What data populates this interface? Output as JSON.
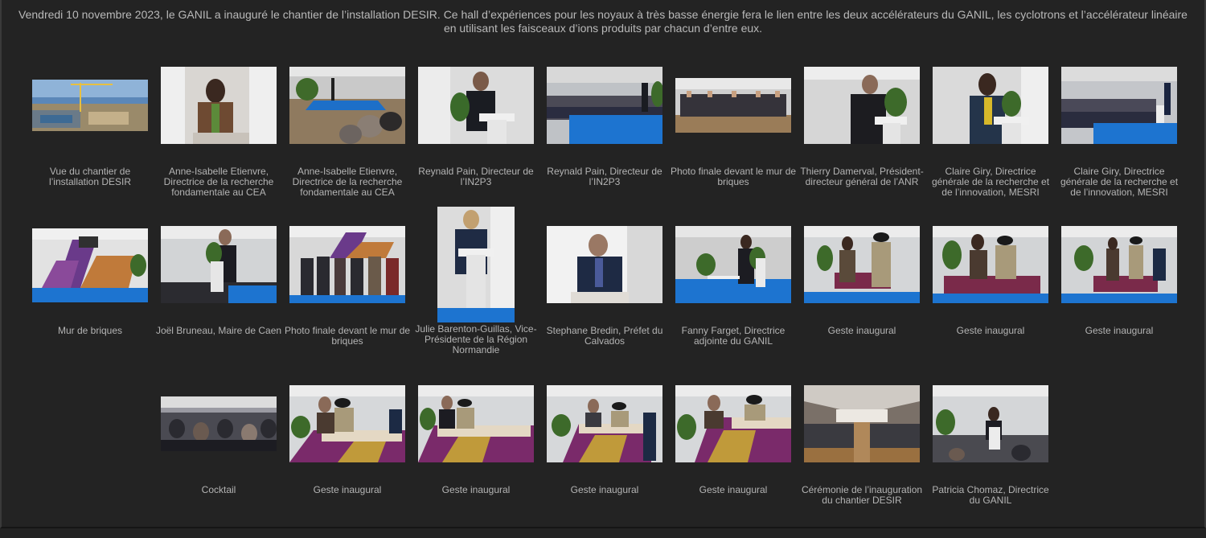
{
  "intro": {
    "line1": "Vendredi 10 novembre 2023, le GANIL a inauguré le chantier de l’installation DESIR. Ce hall d’expériences pour les noyaux à très basse énergie fera le lien entre les deux accélérateurs du GANIL, les cyclotrons et l’accélérateur linéaire",
    "line2": "en utilisant les faisceaux d’ions produits par chacun d’entre eux."
  },
  "gallery": [
    {
      "caption": "Vue du chantier de l’installation DESIR"
    },
    {
      "caption": "Anne-Isabelle Etienvre, Directrice de la recherche fondamentale au CEA"
    },
    {
      "caption": "Anne-Isabelle Etienvre, Directrice de la recherche fondamentale au CEA"
    },
    {
      "caption": "Reynald Pain, Directeur de l’IN2P3"
    },
    {
      "caption": "Reynald Pain, Directeur de l’IN2P3"
    },
    {
      "caption": "Photo finale devant le mur de briques"
    },
    {
      "caption": "Thierry Damerval, Président-directeur général de l’ANR"
    },
    {
      "caption": "Claire Giry, Directrice générale de la recherche et de l’innovation, MESRI"
    },
    {
      "caption": "Claire Giry, Directrice générale de la recherche et de l’innovation, MESRI"
    },
    {
      "caption": "Mur de briques"
    },
    {
      "caption": "Joël Bruneau, Maire de Caen"
    },
    {
      "caption": "Photo finale devant le mur de briques"
    },
    {
      "caption": "Julie Barenton-Guillas, Vice-Présidente de la Région Normandie"
    },
    {
      "caption": "Stephane Bredin, Préfet du Calvados"
    },
    {
      "caption": "Fanny Farget, Directrice adjointe du GANIL"
    },
    {
      "caption": "Geste inaugural"
    },
    {
      "caption": "Geste inaugural"
    },
    {
      "caption": "Geste inaugural"
    },
    {
      "caption": "Cocktail"
    },
    {
      "caption": "Geste inaugural"
    },
    {
      "caption": "Geste inaugural"
    },
    {
      "caption": "Geste inaugural"
    },
    {
      "caption": "Geste inaugural"
    },
    {
      "caption": "Cérémonie de l’inauguration du chantier DESIR"
    },
    {
      "caption": "Patricia Chomaz, Directrice du GANIL"
    }
  ]
}
